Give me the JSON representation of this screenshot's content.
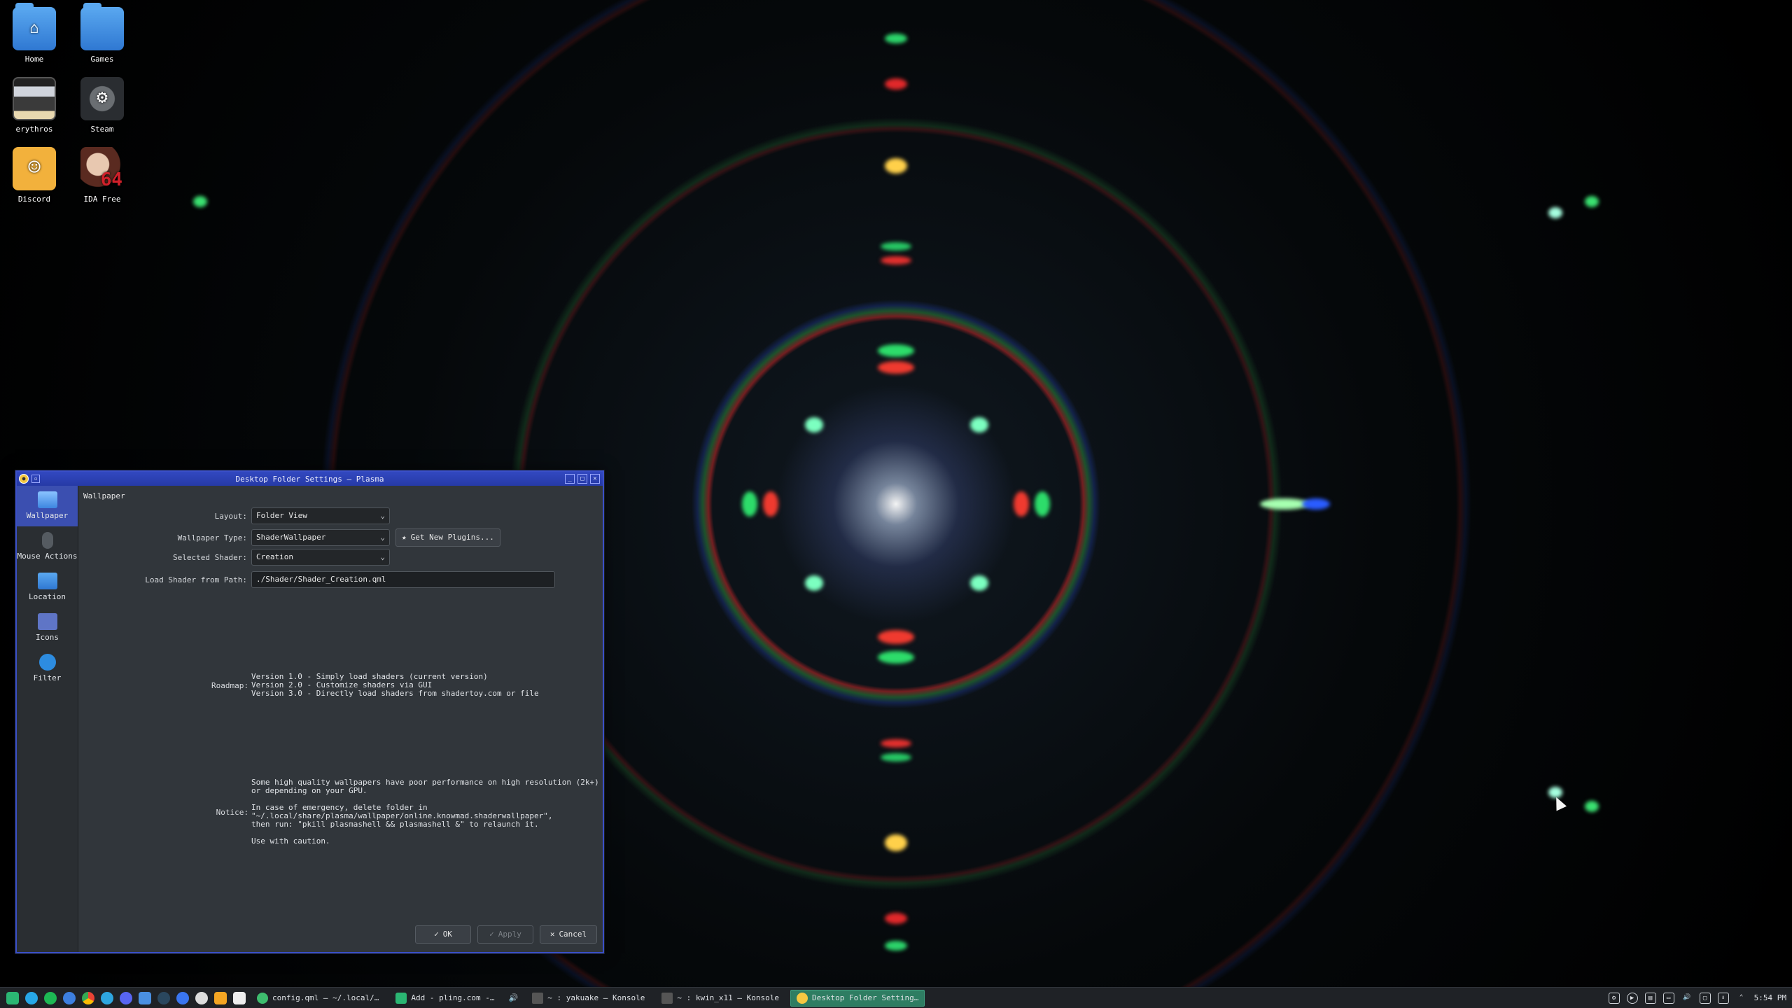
{
  "desktop": {
    "icons": [
      {
        "label": "Home",
        "glyph": "⌂"
      },
      {
        "label": "Games",
        "glyph": ""
      },
      {
        "label": "erythros",
        "glyph": ""
      },
      {
        "label": "Steam",
        "glyph": "⚙"
      },
      {
        "label": "Discord",
        "glyph": "☺"
      },
      {
        "label": "IDA Free",
        "glyph": "64"
      }
    ]
  },
  "window": {
    "title": "Desktop Folder Settings — Plasma",
    "sidebar": [
      {
        "label": "Wallpaper",
        "icon": "wallpaper-icon"
      },
      {
        "label": "Mouse Actions",
        "icon": "mouse-icon"
      },
      {
        "label": "Location",
        "icon": "folder-icon"
      },
      {
        "label": "Icons",
        "icon": "icons-icon"
      },
      {
        "label": "Filter",
        "icon": "filter-icon"
      }
    ],
    "section_title": "Wallpaper",
    "form": {
      "layout_label": "Layout:",
      "layout_value": "Folder View",
      "type_label": "Wallpaper Type:",
      "type_value": "ShaderWallpaper",
      "get_plugins_label": "Get New Plugins...",
      "shader_label": "Selected Shader:",
      "shader_value": "Creation",
      "path_label": "Load Shader from Path:",
      "path_value": "./Shader/Shader_Creation.qml"
    },
    "roadmap_label": "Roadmap:",
    "roadmap_text": "Version 1.0 - Simply load shaders (current version)\nVersion 2.0 - Customize shaders via GUI\nVersion 3.0 - Directly load shaders from shadertoy.com or file",
    "notice_label": "Notice:",
    "notice_text": "Some high quality wallpapers have poor performance on high resolution (2k+)\nor depending on your GPU.\n\nIn case of emergency, delete folder in\n\"~/.local/share/plasma/wallpaper/online.knowmad.shaderwallpaper\",\nthen run: \"pkill plasmashell && plasmashell &\" to relaunch it.\n\nUse with caution.",
    "buttons": {
      "ok": "OK",
      "apply": "Apply",
      "cancel": "Cancel"
    }
  },
  "taskbar": {
    "tasks": [
      {
        "label": "config.qml — ~/.local/…",
        "active": false
      },
      {
        "label": "Add - pling.com -…",
        "active": false
      },
      {
        "label": "~ : yakuake — Konsole",
        "active": false
      },
      {
        "label": "~ : kwin_x11 — Konsole",
        "active": false
      },
      {
        "label": "Desktop Folder Setting…",
        "active": true
      }
    ],
    "clock": "5:54 PM"
  },
  "colors": {
    "accent": "#3b4fb0",
    "titlebar": "#2a40b4",
    "active_task": "#2e7d62"
  }
}
